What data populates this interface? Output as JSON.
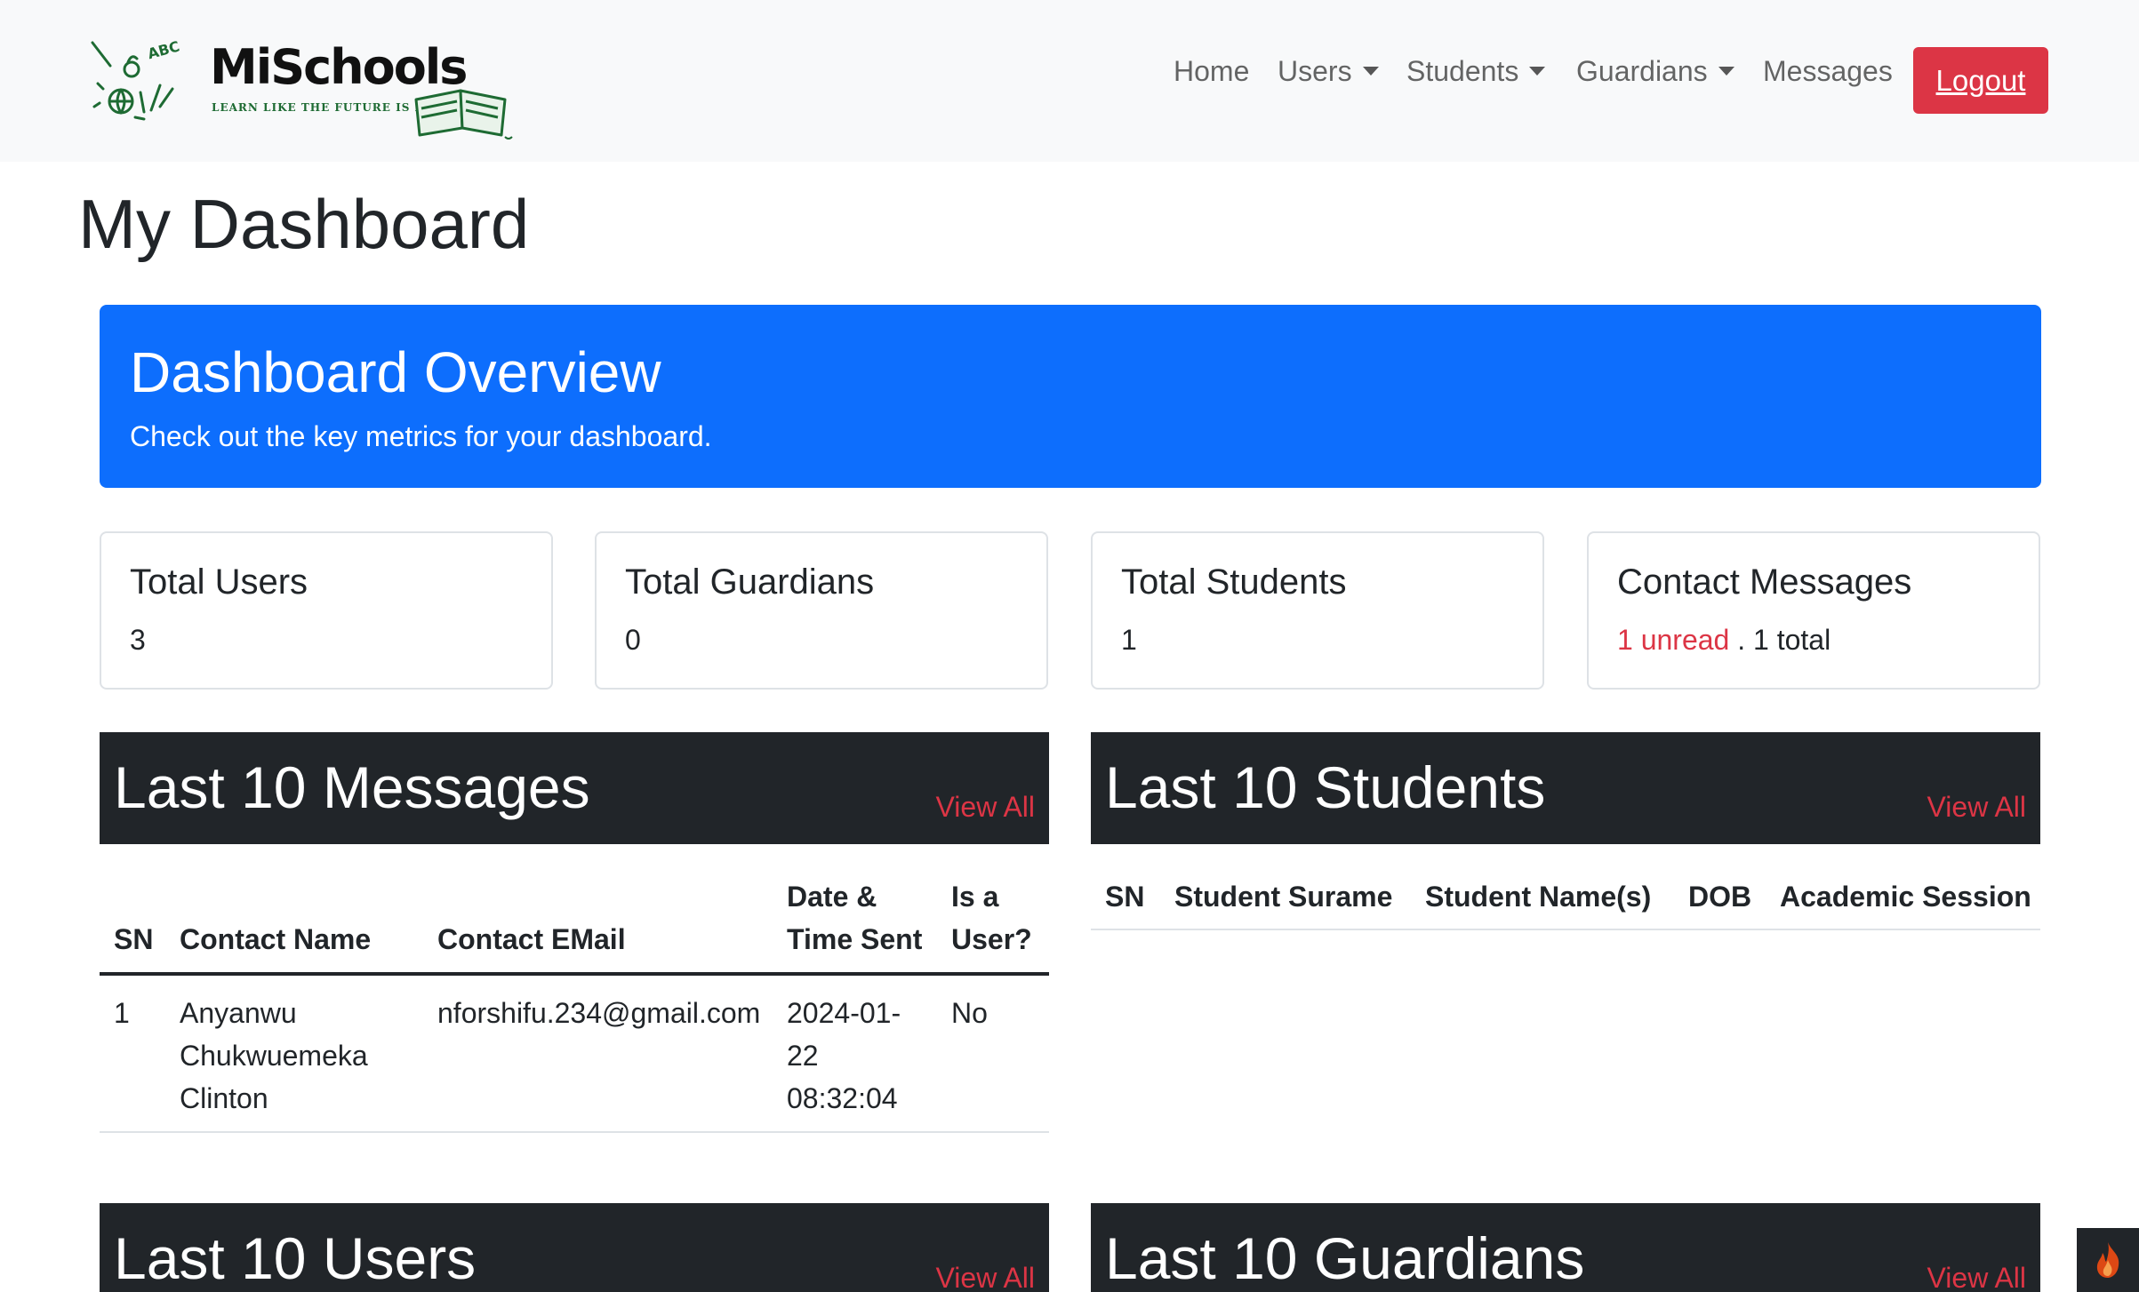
{
  "brand": {
    "name": "MiSchools",
    "tagline": "LEARN LIKE THE FUTURE IS NOW",
    "doodle_text": "ABC",
    "primary_color": "#0d6efd",
    "danger_color": "#dc3545",
    "dark_color": "#212529"
  },
  "nav": {
    "home": "Home",
    "users": "Users",
    "students": "Students",
    "guardians": "Guardians",
    "messages": "Messages",
    "logout": "Logout"
  },
  "page_title": "My Dashboard",
  "overview": {
    "title": "Dashboard Overview",
    "subtitle": "Check out the key metrics for your dashboard."
  },
  "cards": {
    "users": {
      "title": "Total Users",
      "value": "3"
    },
    "guardians": {
      "title": "Total Guardians",
      "value": "0"
    },
    "students": {
      "title": "Total Students",
      "value": "1"
    },
    "messages": {
      "title": "Contact Messages",
      "unread": "1 unread",
      "separator": ".",
      "total": "1 total"
    }
  },
  "messages_section": {
    "title": "Last 10 Messages",
    "view_all": "View All",
    "headers": {
      "sn": "SN",
      "name": "Contact Name",
      "email": "Contact EMail",
      "date_l1": "Date &",
      "date_l2": "Time Sent",
      "user_l1": "Is a",
      "user_l2": "User?"
    },
    "rows": [
      {
        "sn": "1",
        "name_l1": "Anyanwu",
        "name_l2": "Chukwuemeka",
        "name_l3": "Clinton",
        "email": "nforshifu.234@gmail.com",
        "date_l1": "2024-01-",
        "date_l2": "22",
        "date_l3": "08:32:04",
        "is_user": "No"
      }
    ]
  },
  "students_section": {
    "title": "Last 10 Students",
    "view_all": "View All",
    "headers": {
      "sn": "SN",
      "surname": "Student Surame",
      "names": "Student Name(s)",
      "dob": "DOB",
      "session": "Academic Session"
    }
  },
  "users_section": {
    "title": "Last 10 Users",
    "view_all": "View All"
  },
  "guardians_section": {
    "title": "Last 10 Guardians",
    "view_all": "View All"
  }
}
